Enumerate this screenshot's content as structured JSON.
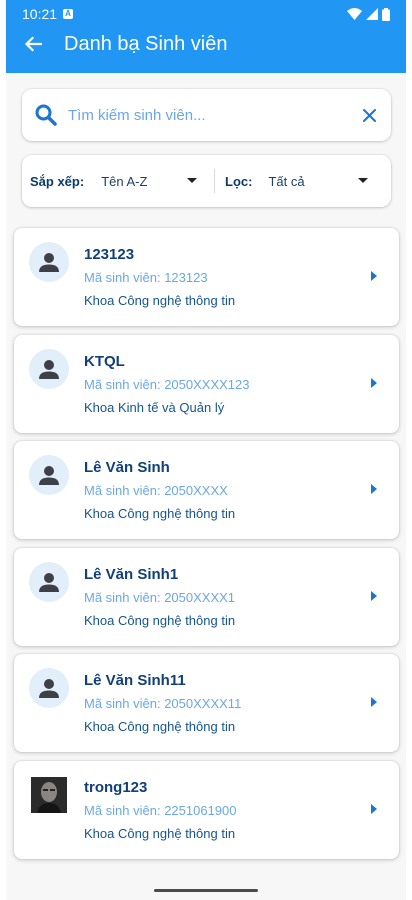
{
  "status_bar": {
    "time": "10:21",
    "notification_letter": "A",
    "icons": [
      "wifi-icon",
      "signal-icon",
      "battery-icon"
    ]
  },
  "app_bar": {
    "title": "Danh bạ Sinh viên",
    "back_icon": "arrow-left-icon",
    "color": "#2196F3"
  },
  "search": {
    "placeholder": "Tìm kiếm sinh viên...",
    "value": "",
    "icon": "search-icon",
    "clear_icon": "close-icon"
  },
  "sort": {
    "label": "Sắp xếp:",
    "value": "Tên A-Z"
  },
  "filter": {
    "label": "Lọc:",
    "value": "Tất cả"
  },
  "students": [
    {
      "name": "123123",
      "student_id": "Mã sinh viên: 123123",
      "faculty": "Khoa Công nghệ thông tin",
      "avatar": "person-icon"
    },
    {
      "name": "KTQL",
      "student_id": "Mã sinh viên: 2050XXXX123",
      "faculty": "Khoa Kinh tế và Quản lý",
      "avatar": "person-icon"
    },
    {
      "name": "Lê Văn Sinh",
      "student_id": "Mã sinh viên: 2050XXXX",
      "faculty": "Khoa Công nghệ thông tin",
      "avatar": "person-icon"
    },
    {
      "name": "Lê Văn Sinh1",
      "student_id": "Mã sinh viên: 2050XXXX1",
      "faculty": "Khoa Công nghệ thông tin",
      "avatar": "person-icon"
    },
    {
      "name": "Lê Văn Sinh11",
      "student_id": "Mã sinh viên: 2050XXXX11",
      "faculty": "Khoa Công nghệ thông tin",
      "avatar": "person-icon"
    },
    {
      "name": "trong123",
      "student_id": "Mã sinh viên: 2251061900",
      "faculty": "Khoa Công nghệ thông tin",
      "avatar": "photo"
    }
  ]
}
